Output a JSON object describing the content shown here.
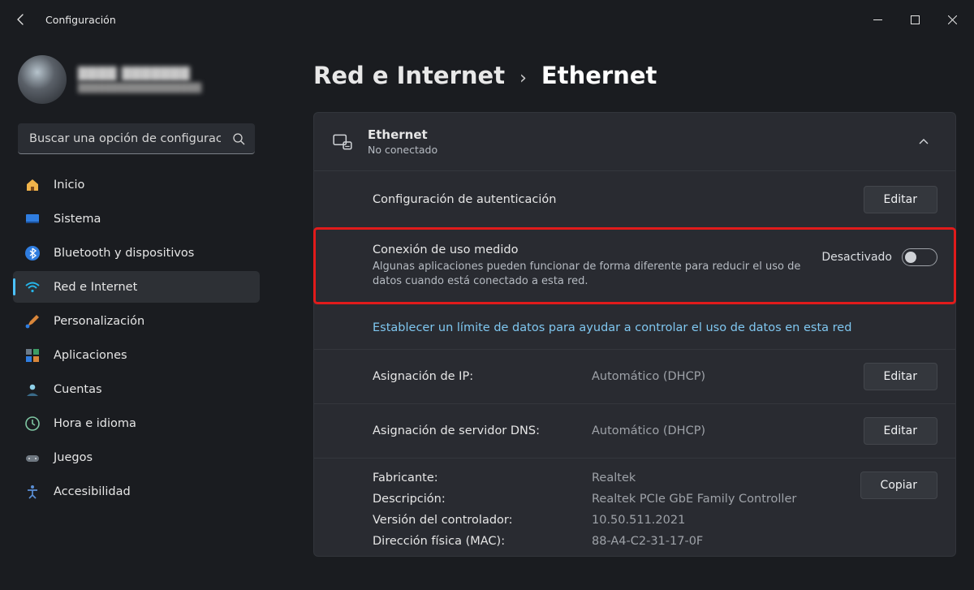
{
  "window": {
    "title": "Configuración"
  },
  "profile": {
    "name": "████ ███████",
    "email": "██████████████████"
  },
  "search": {
    "placeholder": "Buscar una opción de configuración"
  },
  "nav": [
    {
      "label": "Inicio"
    },
    {
      "label": "Sistema"
    },
    {
      "label": "Bluetooth y dispositivos"
    },
    {
      "label": "Red e Internet"
    },
    {
      "label": "Personalización"
    },
    {
      "label": "Aplicaciones"
    },
    {
      "label": "Cuentas"
    },
    {
      "label": "Hora e idioma"
    },
    {
      "label": "Juegos"
    },
    {
      "label": "Accesibilidad"
    }
  ],
  "breadcrumb": {
    "root": "Red e Internet",
    "leaf": "Ethernet"
  },
  "ethernet_header": {
    "title": "Ethernet",
    "status": "No conectado"
  },
  "auth": {
    "label": "Configuración de autenticación",
    "button": "Editar"
  },
  "metered": {
    "title": "Conexión de uso medido",
    "desc": "Algunas aplicaciones pueden funcionar de forma diferente para reducir el uso de datos cuando está conectado a esta red.",
    "state": "Desactivado"
  },
  "datalimit_link": "Establecer un límite de datos para ayudar a controlar el uso de datos en esta red",
  "ip": {
    "label": "Asignación de IP:",
    "value": "Automático (DHCP)",
    "button": "Editar"
  },
  "dns": {
    "label": "Asignación de servidor DNS:",
    "value": "Automático (DHCP)",
    "button": "Editar"
  },
  "info": {
    "button": "Copiar",
    "rows": [
      {
        "k": "Fabricante:",
        "v": "Realtek"
      },
      {
        "k": "Descripción:",
        "v": "Realtek PCIe GbE Family Controller"
      },
      {
        "k": "Versión del controlador:",
        "v": "10.50.511.2021"
      },
      {
        "k": "Dirección física (MAC):",
        "v": "88-A4-C2-31-17-0F"
      }
    ]
  }
}
